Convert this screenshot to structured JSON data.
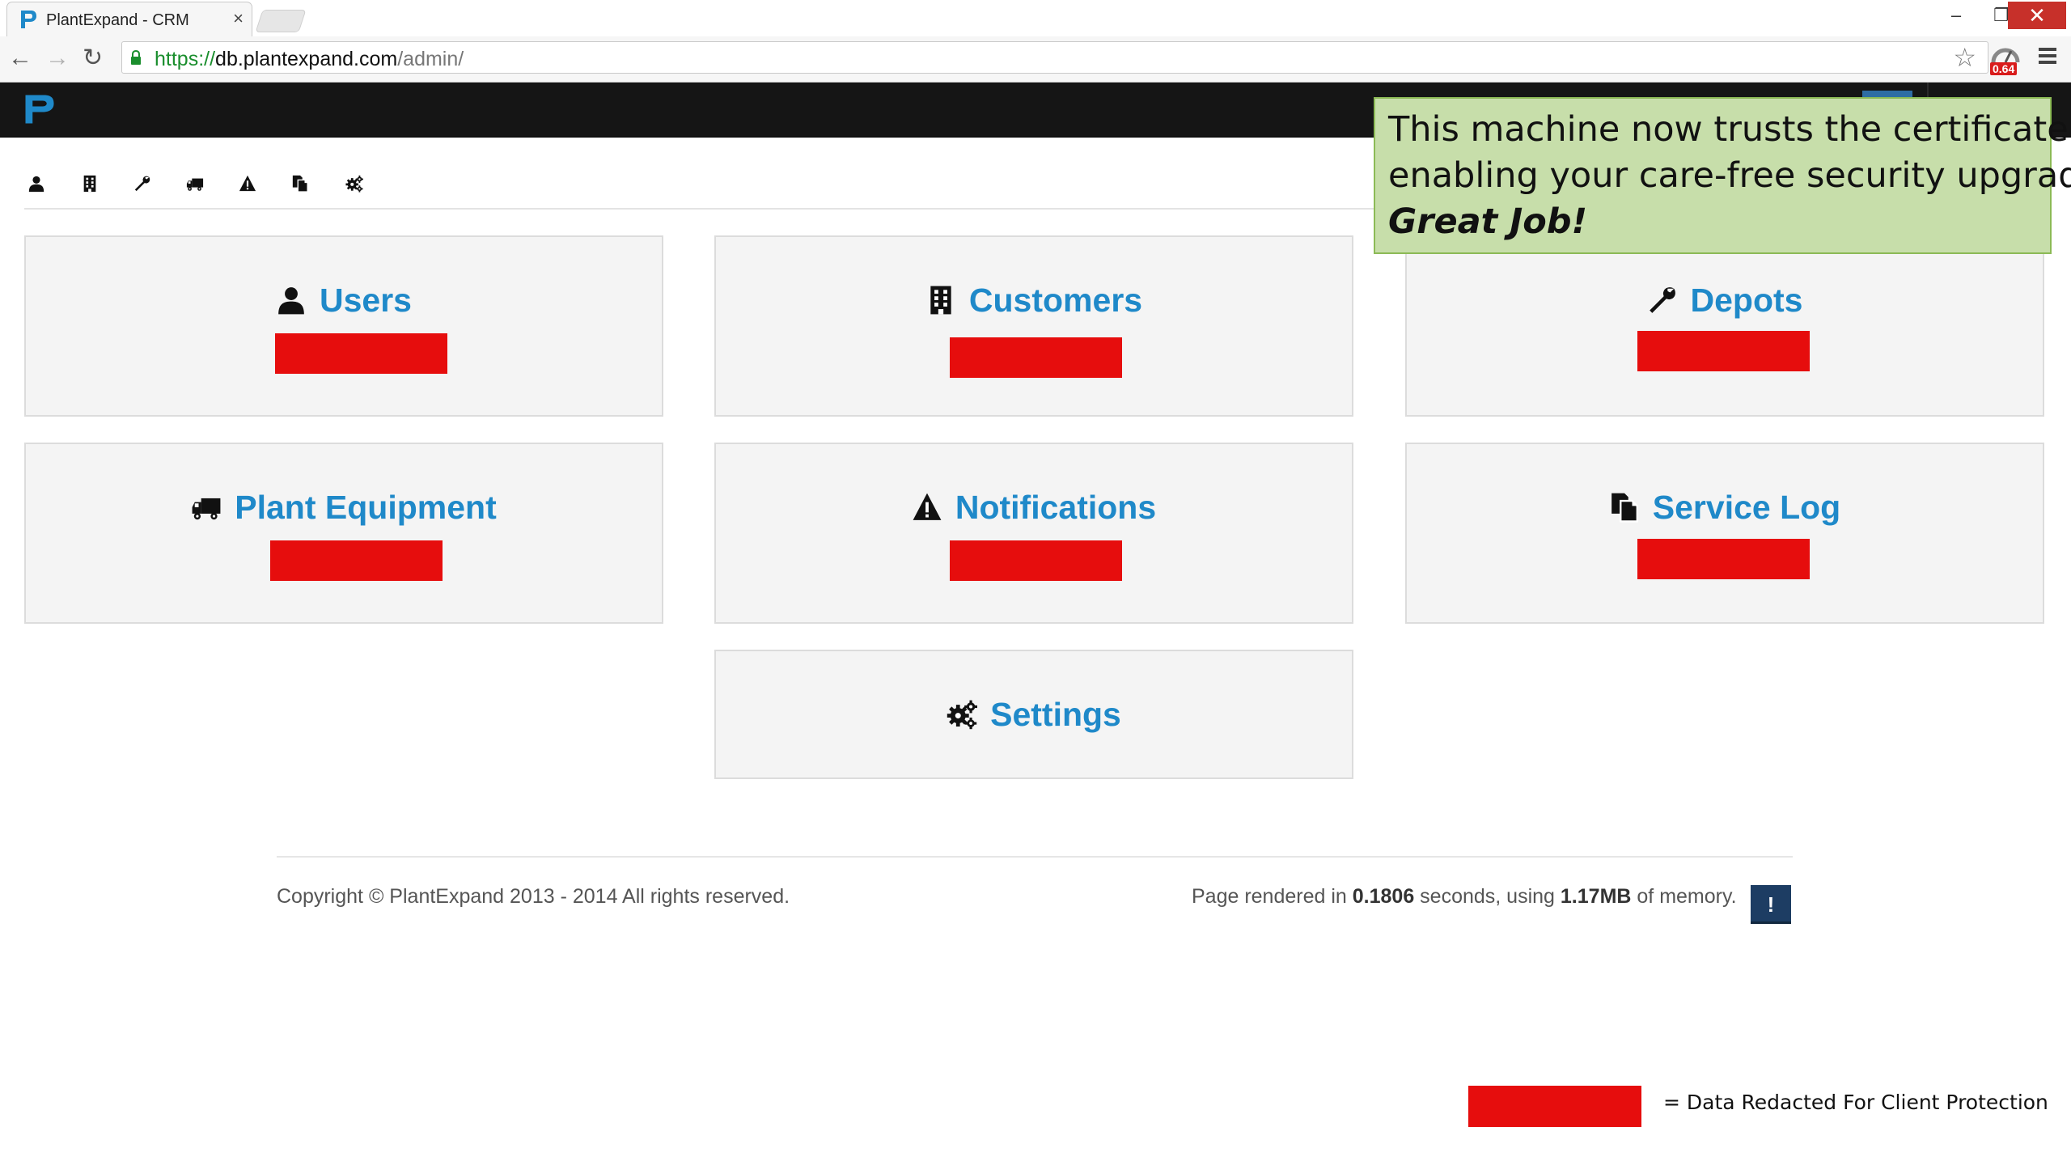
{
  "browser": {
    "tab_title": "PlantExpand - CRM",
    "tab_close": "×",
    "url_protocol": "https://",
    "url_host": "db.plantexpand.com",
    "url_path": "/admin/",
    "extension_badge": "0.64",
    "window_min": "–",
    "window_max": "❐",
    "window_close": "✕",
    "back": "←",
    "forward": "→",
    "reload": "↻",
    "star": "☆"
  },
  "toast": {
    "line1": "This machine now trusts the certificate,",
    "line2": "enabling your care-free security upgrade",
    "line3": "Great Job!"
  },
  "icon_bar": [
    "user-icon",
    "building-icon",
    "wrench-icon",
    "truck-icon",
    "warning-icon",
    "copy-icon",
    "cogs-icon"
  ],
  "tiles": [
    {
      "label": "Users",
      "icon": "user-icon",
      "redacted": true
    },
    {
      "label": "Customers",
      "icon": "building-icon",
      "redacted": true
    },
    {
      "label": "Depots",
      "icon": "wrench-icon",
      "redacted": true
    },
    {
      "label": "Plant Equipment",
      "icon": "truck-icon",
      "redacted": true
    },
    {
      "label": "Notifications",
      "icon": "warning-icon",
      "redacted": true
    },
    {
      "label": "Service Log",
      "icon": "copy-icon",
      "redacted": true
    },
    {
      "label": "Settings",
      "icon": "cogs-icon",
      "redacted": false
    }
  ],
  "footer": {
    "copyright": "Copyright © PlantExpand 2013 - 2014 All rights reserved.",
    "perf_prefix": "Page rendered in ",
    "perf_time": "0.1806",
    "perf_middle": " seconds, using ",
    "perf_memory": "1.17MB",
    "perf_suffix": " of memory.",
    "debug_label": "!"
  },
  "legend": {
    "text": "= Data Redacted For Client Protection"
  },
  "colors": {
    "accent": "#1f89c9",
    "redaction": "#e60d0d",
    "navbar": "#151515",
    "toast_bg": "#c7deaa"
  }
}
